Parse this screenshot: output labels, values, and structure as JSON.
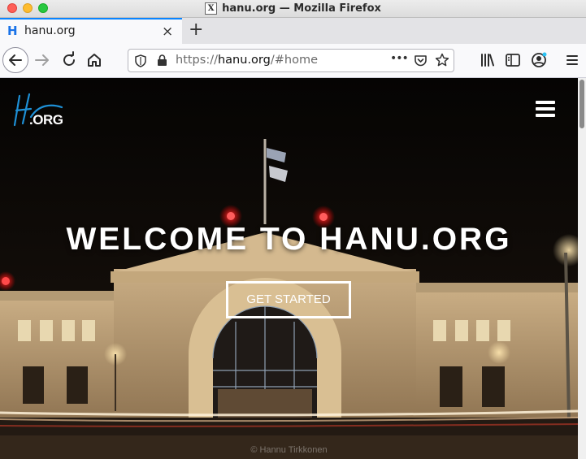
{
  "window": {
    "title": "hanu.org — Mozilla Firefox",
    "title_icon_glyph": "X"
  },
  "tabs": [
    {
      "label": "hanu.org",
      "favicon_glyph": "H",
      "close_glyph": "×"
    }
  ],
  "new_tab_glyph": "+",
  "navbar": {
    "url_prefix": "https://",
    "url_host": "hanu.org",
    "url_path": "/#home",
    "page_actions_glyph": "•••"
  },
  "icons": {
    "back": "arrow-left-icon",
    "forward": "arrow-right-icon",
    "reload": "reload-icon",
    "home": "home-icon",
    "shield": "shield-icon",
    "lock": "lock-icon",
    "pocket": "pocket-icon",
    "bookmark": "star-icon",
    "library": "library-icon",
    "sidebar": "sidebar-icon",
    "account": "account-icon",
    "menu": "hamburger-menu-icon"
  },
  "page": {
    "logo_script": "Ha",
    "logo_text": ".ORG",
    "hero_title": "WELCOME TO HANU.ORG",
    "cta_label": "GET STARTED",
    "photo_credit": "© Hannu Tirkkonen",
    "background_description_colors": {
      "sky": "#0a0807",
      "accent": "#1e90d6"
    }
  },
  "colors": {
    "tab_accent": "#0a84ff",
    "logo_blue": "#1e90d6"
  }
}
